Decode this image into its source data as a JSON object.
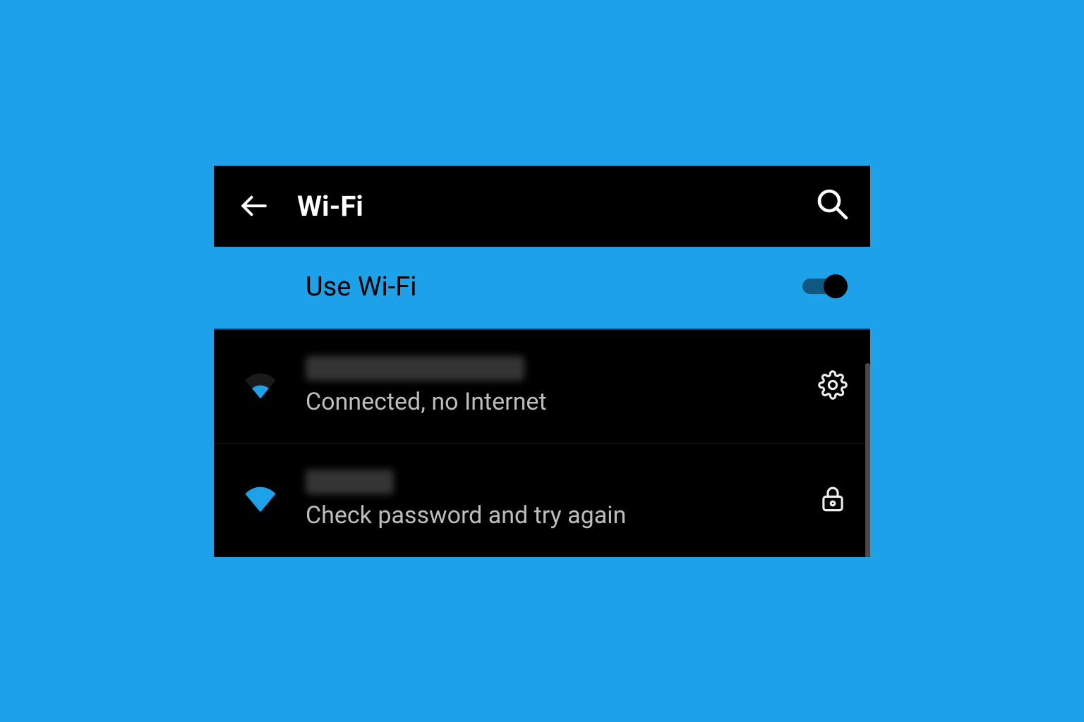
{
  "header": {
    "title": "Wi-Fi"
  },
  "toggle": {
    "label": "Use Wi-Fi",
    "enabled": true
  },
  "networks": [
    {
      "name_redacted": true,
      "status": "Connected, no Internet",
      "signal": "weak",
      "side_icon": "gear"
    },
    {
      "name_redacted": true,
      "status": "Check password and try again",
      "signal": "full",
      "side_icon": "lock"
    }
  ],
  "colors": {
    "accent": "#1da1e8",
    "bg": "#000000",
    "text_muted": "#bdbdbd"
  }
}
